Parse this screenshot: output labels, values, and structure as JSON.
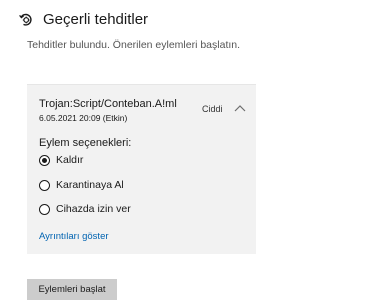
{
  "header": {
    "title": "Geçerli tehditler",
    "icon": "virus-scan-icon",
    "subtitle": "Tehditler bulundu. Önerilen eylemleri başlatın."
  },
  "threat": {
    "name": "Trojan:Script/Conteban.A!ml",
    "date": "6.05.2021 20:09 (Etkin)",
    "severity": "Ciddi",
    "expanded": true
  },
  "actions": {
    "label": "Eylem seçenekleri:",
    "options": [
      {
        "label": "Kaldır",
        "selected": true
      },
      {
        "label": "Karantinaya Al",
        "selected": false
      },
      {
        "label": "Cihazda izin ver",
        "selected": false
      }
    ]
  },
  "details_link": "Ayrıntıları göster",
  "start_button": "Eylemleri başlat",
  "colors": {
    "link": "#0063b1",
    "card_background": "#f2f2f2",
    "button_background": "#cccccc"
  }
}
